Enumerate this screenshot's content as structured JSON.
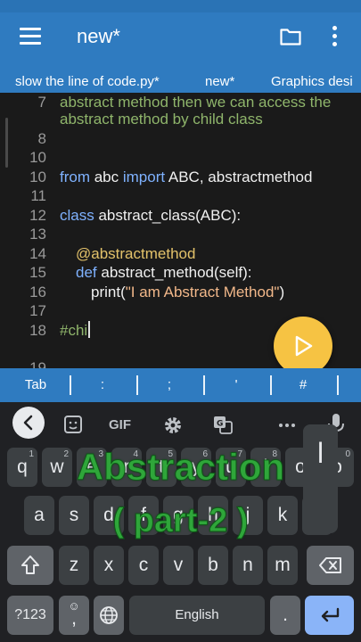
{
  "appbar": {
    "title": "new*"
  },
  "tabs": [
    {
      "label": "slow the line of code.py*"
    },
    {
      "label": "new*"
    },
    {
      "label": "Graphics desi"
    }
  ],
  "editor": {
    "lines": [
      {
        "num": "7",
        "text": "abstract method then we can access the"
      },
      {
        "num": "",
        "text": "abstract method by child class"
      },
      {
        "num": "8",
        "text": ""
      },
      {
        "num": "10",
        "text": ""
      },
      {
        "num": "10",
        "kw1": "from",
        "mid": " abc ",
        "kw2": "import",
        "rest": " ABC, abstractmethod"
      },
      {
        "num": "11",
        "text": ""
      },
      {
        "num": "12",
        "kw1": "class",
        "rest": " abstract_class(ABC):"
      },
      {
        "num": "13",
        "text": ""
      },
      {
        "num": "14",
        "dec": "@abstractmethod"
      },
      {
        "num": "15",
        "kw1": "def",
        "rest": " abstract_method(self):"
      },
      {
        "num": "16",
        "pre": "print(",
        "str": "\"I am Abstract Method\"",
        "post": ")"
      },
      {
        "num": "17",
        "text": ""
      },
      {
        "num": "18",
        "cm": "#chi"
      },
      {
        "num": "19",
        "text": ""
      }
    ]
  },
  "symbols": [
    "Tab",
    ":",
    ";",
    "'",
    "#"
  ],
  "keyboard": {
    "toolbar": {
      "gif": "GIF"
    },
    "row1": [
      {
        "label": "q",
        "sub": "1"
      },
      {
        "label": "w",
        "sub": "2"
      },
      {
        "label": "e",
        "sub": "3"
      },
      {
        "label": "r",
        "sub": "4"
      },
      {
        "label": "t",
        "sub": "5"
      },
      {
        "label": "y",
        "sub": "6"
      },
      {
        "label": "u",
        "sub": "7"
      },
      {
        "label": "i",
        "sub": "8"
      },
      {
        "label": "o",
        "sub": "9"
      },
      {
        "label": "p",
        "sub": "0"
      }
    ],
    "row2": [
      "a",
      "s",
      "d",
      "f",
      "g",
      "h",
      "j",
      "k",
      "l"
    ],
    "row3": [
      "z",
      "x",
      "c",
      "v",
      "b",
      "n",
      "m"
    ],
    "numbers_key": "?123",
    "comma_key": ",",
    "space_label": "English",
    "period_key": ".",
    "popup_char": "l"
  },
  "overlay": {
    "line1": "Abstraction",
    "line2": "( part-2 )"
  }
}
